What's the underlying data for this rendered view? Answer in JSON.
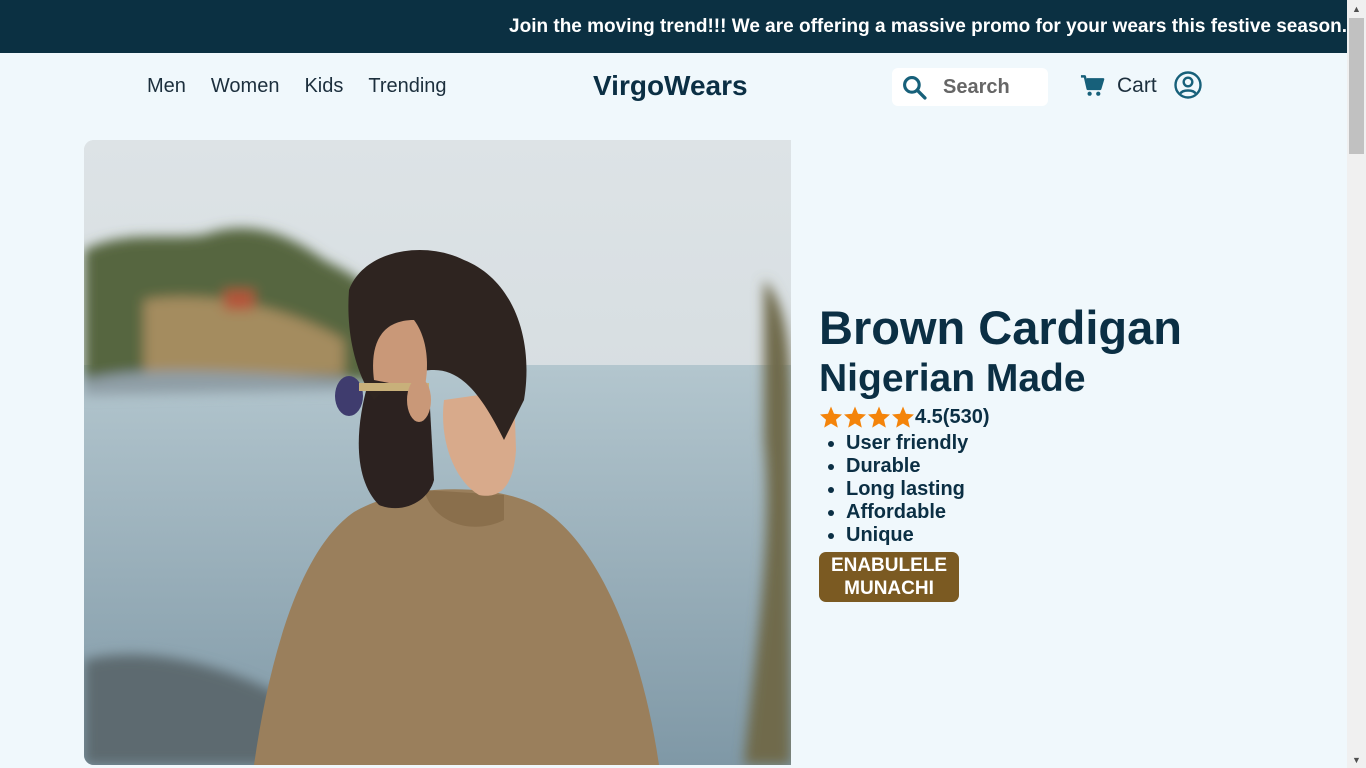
{
  "promo": {
    "text": "Join the moving trend!!! We are offering a massive promo for your wears this festive season."
  },
  "nav": {
    "links": [
      "Men",
      "Women",
      "Kids",
      "Trending"
    ],
    "logo": "VirgoWears",
    "search_placeholder": "Search",
    "cart_label": "Cart",
    "search_icon": "search-icon",
    "cart_icon": "cart-icon",
    "user_icon": "user-circle-icon"
  },
  "product": {
    "title": "Brown Cardigan",
    "subtitle": "Nigerian Made",
    "rating_display": "4.5(530)",
    "stars_shown": 4,
    "star_color": "#f4840a",
    "features": [
      "User friendly",
      "Durable",
      "Long lasting",
      "Affordable",
      "Unique"
    ],
    "designer_line1": "ENABULELE",
    "designer_line2": "MUNACHI",
    "badge_color": "#7b5a22"
  },
  "colors": {
    "promo_bg": "#0b3042",
    "page_bg": "#f0f8fc",
    "text_dark": "#0b2f44",
    "accent_icon": "#17607a"
  }
}
